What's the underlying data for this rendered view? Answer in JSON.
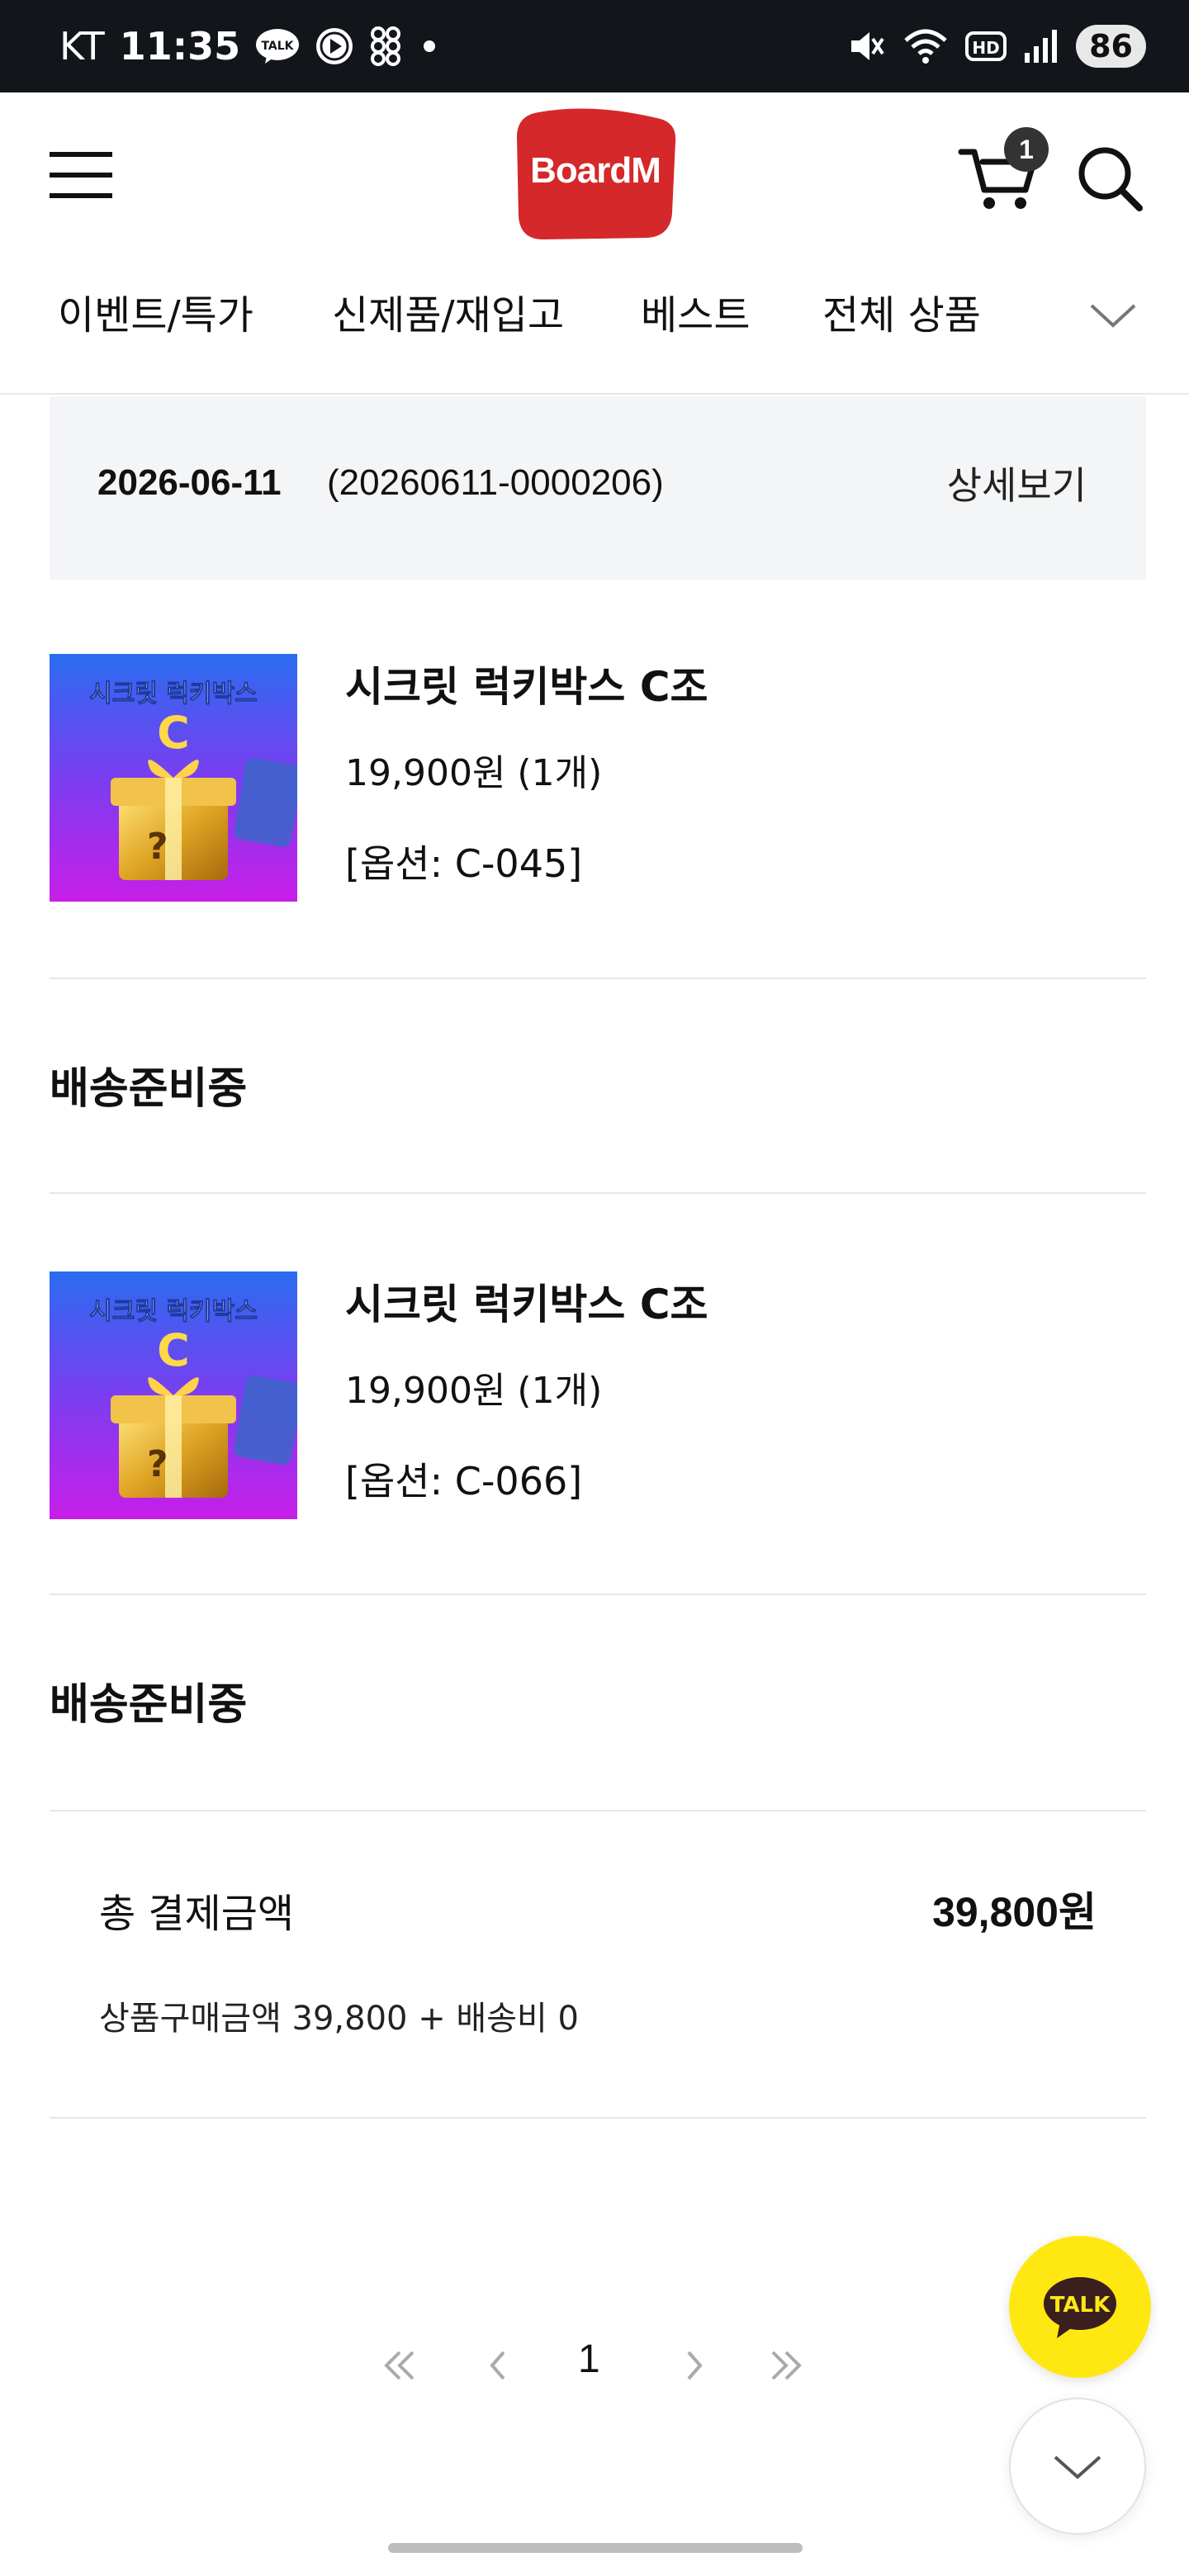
{
  "status_bar": {
    "carrier": "KT",
    "time": "11:35",
    "talk_icon_text": "TALK",
    "battery": "86"
  },
  "header": {
    "logo": "BoardM",
    "cart_count": "1",
    "colors": {
      "logo_bg": "#d4282a"
    }
  },
  "categories": [
    {
      "label": "이벤트/특가"
    },
    {
      "label": "신제품/재입고"
    },
    {
      "label": "베스트"
    },
    {
      "label": "전체 상품"
    }
  ],
  "order": {
    "date": "2026-06-11",
    "number": "(20260611-0000206)",
    "detail_label": "상세보기"
  },
  "items": [
    {
      "name": "시크릿 럭키박스 C조",
      "price": "19,900원 (1개)",
      "option": "[옵션: C-045]",
      "status": "배송준비중",
      "thumb_title": "시크릿 럭키박스",
      "thumb_letter": "C"
    },
    {
      "name": "시크릿 럭키박스 C조",
      "price": "19,900원 (1개)",
      "option": "[옵션: C-066]",
      "status": "배송준비중",
      "thumb_title": "시크릿 럭키박스",
      "thumb_letter": "C"
    }
  ],
  "summary": {
    "total_label": "총 결제금액",
    "total_value": "39,800원",
    "breakdown": "상품구매금액 39,800 + 배송비 0"
  },
  "pagination": {
    "current": "1"
  },
  "floating": {
    "talk_label": "TALK"
  }
}
